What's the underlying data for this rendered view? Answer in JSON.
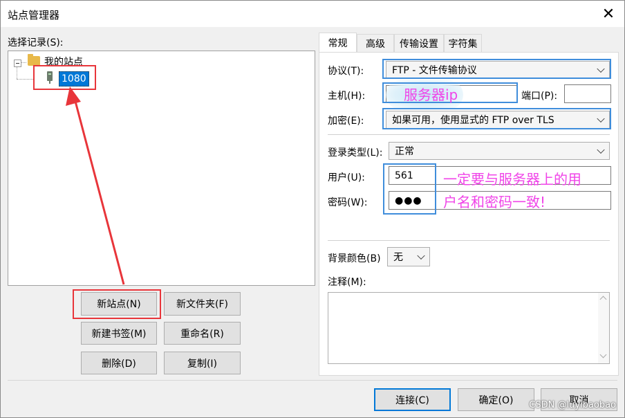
{
  "window": {
    "title": "站点管理器"
  },
  "left": {
    "select_label": "选择记录(S):",
    "tree": {
      "root_label": "我的站点",
      "site_label": "1080"
    },
    "buttons": {
      "new_site": "新站点(N)",
      "new_folder": "新文件夹(F)",
      "new_bookmark": "新建书签(M)",
      "rename": "重命名(R)",
      "delete": "删除(D)",
      "copy": "复制(I)"
    }
  },
  "tabs": [
    "常规",
    "高级",
    "传输设置",
    "字符集"
  ],
  "general": {
    "protocol_label": "协议(T):",
    "protocol_value": "FTP - 文件传输协议",
    "host_label": "主机(H):",
    "host_value": "",
    "port_label": "端口(P):",
    "port_value": "",
    "encryption_label": "加密(E):",
    "encryption_value": "如果可用，使用显式的 FTP over TLS",
    "login_type_label": "登录类型(L):",
    "login_type_value": "正常",
    "user_label": "用户(U):",
    "user_value": "561",
    "password_label": "密码(W):",
    "password_value": "●●●",
    "bg_color_label": "背景颜色(B)",
    "bg_color_value": "无",
    "comments_label": "注释(M):"
  },
  "annotations": {
    "server_ip": "服务器ip",
    "note_line1": "一定要与服务器上的用",
    "note_line2": "户名和密码一致!"
  },
  "footer": {
    "connect": "连接(C)",
    "ok": "确定(O)",
    "cancel": "取消"
  },
  "watermark": "CSDN @luyibaobao",
  "colors": {
    "annotation_red": "#e8353a",
    "annotation_blue": "#3f8ddb",
    "annotation_magenta": "#f044e8",
    "selection": "#0078d7"
  }
}
